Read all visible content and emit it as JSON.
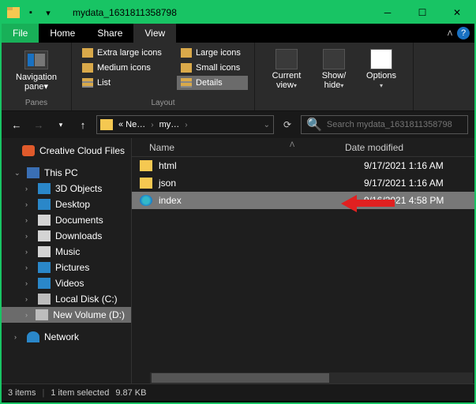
{
  "window": {
    "title": "mydata_1631811358798"
  },
  "tabs": {
    "file": "File",
    "home": "Home",
    "share": "Share",
    "view": "View"
  },
  "ribbon": {
    "panes_group": "Panes",
    "layout_group": "Layout",
    "nav_pane": "Navigation\npane",
    "extra_large": "Extra large icons",
    "large": "Large icons",
    "medium": "Medium icons",
    "small": "Small icons",
    "list": "List",
    "details": "Details",
    "current_view": "Current\nview",
    "show_hide": "Show/\nhide",
    "options": "Options"
  },
  "breadcrumb": {
    "b1": "« Ne…",
    "b2": "my…"
  },
  "search": {
    "placeholder": "Search mydata_1631811358798"
  },
  "tree": {
    "ccf": "Creative Cloud Files",
    "pc": "This PC",
    "obj": "3D Objects",
    "desk": "Desktop",
    "doc": "Documents",
    "down": "Downloads",
    "mus": "Music",
    "pic": "Pictures",
    "vid": "Videos",
    "cdisk": "Local Disk (C:)",
    "ddisk": "New Volume (D:)",
    "net": "Network"
  },
  "columns": {
    "name": "Name",
    "date": "Date modified"
  },
  "files": [
    {
      "name": "html",
      "date": "9/17/2021 1:16 AM",
      "type": "folder"
    },
    {
      "name": "json",
      "date": "9/17/2021 1:16 AM",
      "type": "folder"
    },
    {
      "name": "index",
      "date": "9/16/2021 4:58 PM",
      "type": "html",
      "selected": true
    }
  ],
  "status": {
    "count": "3 items",
    "selected": "1 item selected",
    "size": "9.87 KB"
  }
}
